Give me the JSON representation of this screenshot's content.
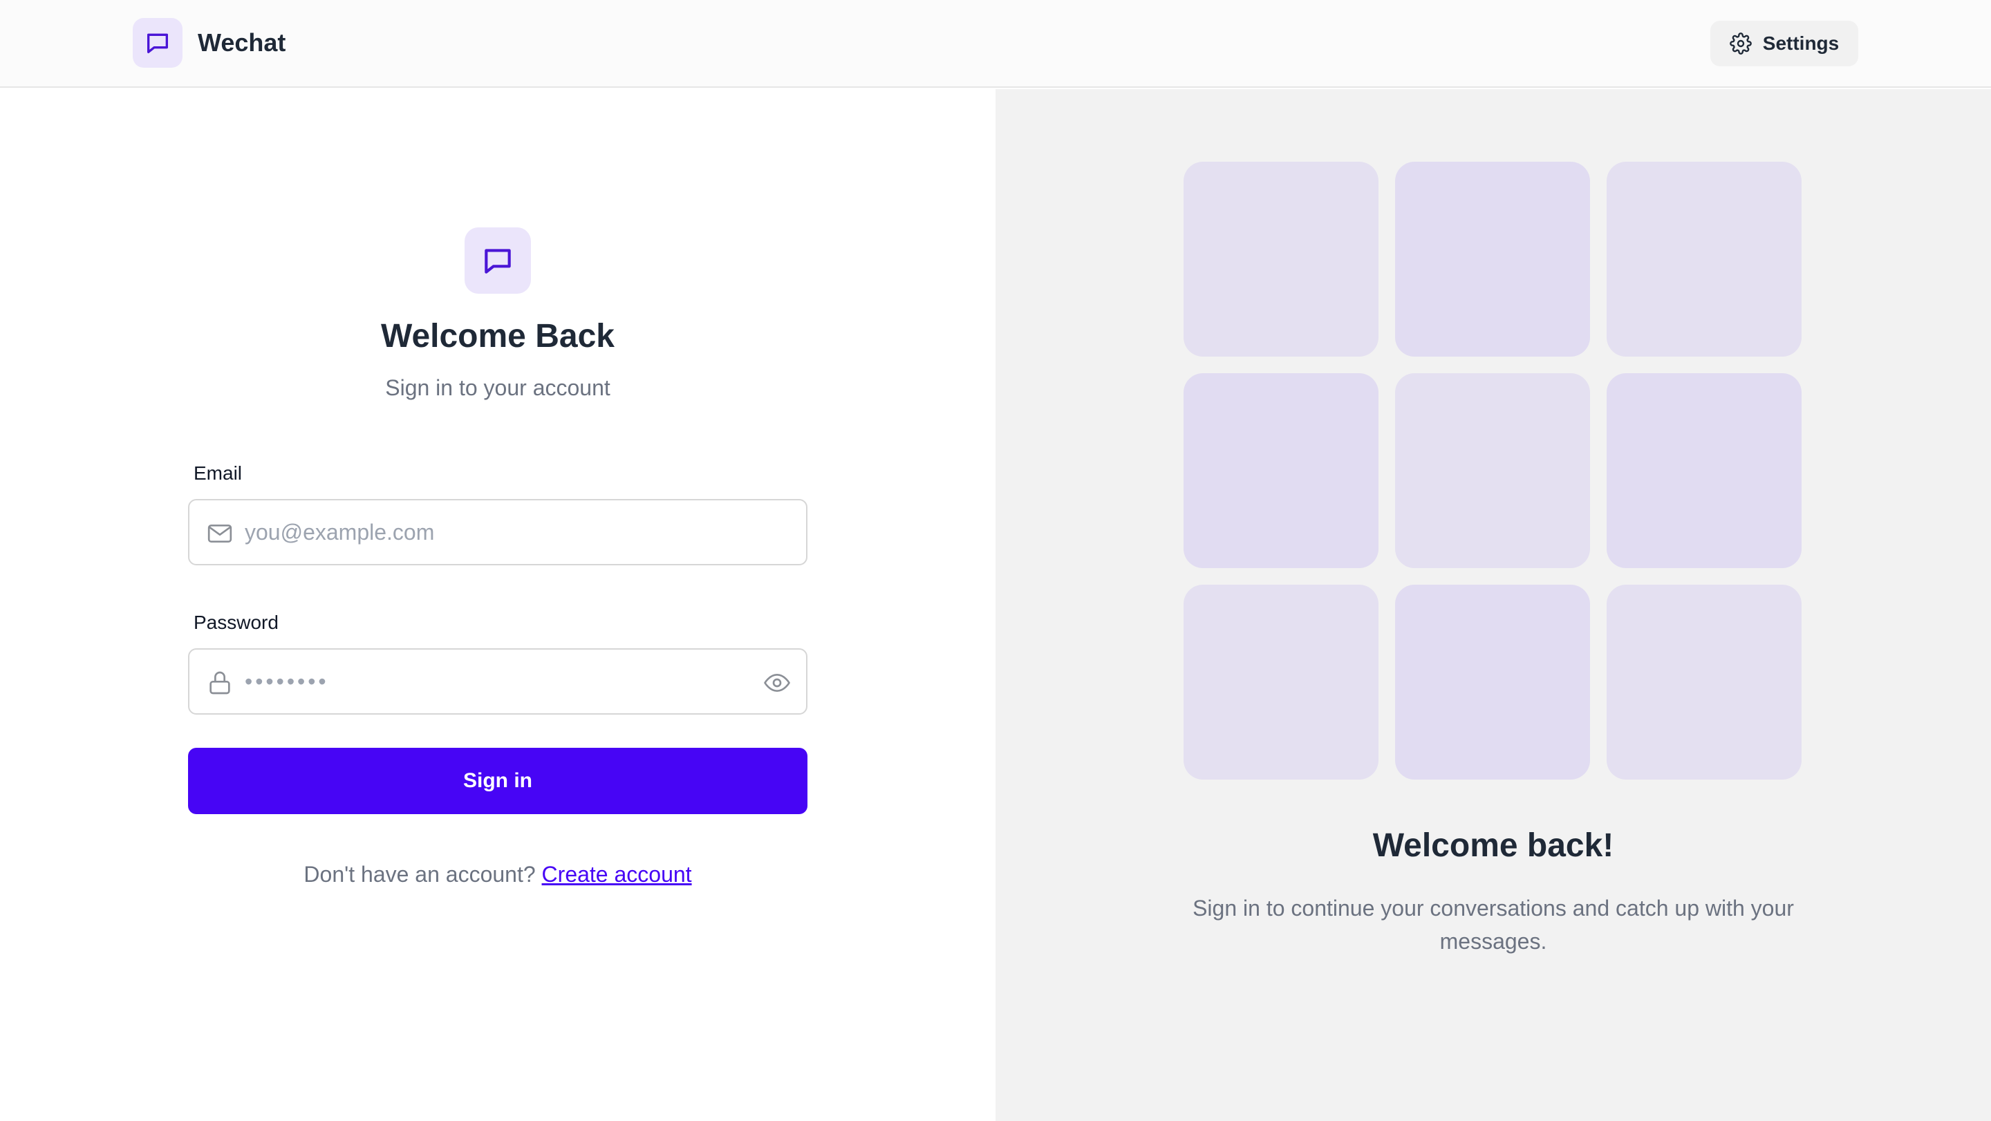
{
  "header": {
    "app_name": "Wechat",
    "logo_icon": "chat-bubble-icon",
    "settings_label": "Settings",
    "settings_icon": "gear-icon"
  },
  "login": {
    "hero_icon": "chat-bubble-icon",
    "title": "Welcome Back",
    "subtitle": "Sign in to your account",
    "email": {
      "label": "Email",
      "placeholder": "you@example.com",
      "value": "",
      "icon": "mail-icon"
    },
    "password": {
      "label": "Password",
      "placeholder": "••••••••",
      "value": "",
      "icon": "lock-icon",
      "toggle_icon": "eye-icon"
    },
    "submit_label": "Sign in",
    "signup_prompt": "Don't have an account?",
    "signup_link": "Create account"
  },
  "side_panel": {
    "title": "Welcome back!",
    "text": "Sign in to continue your conversations and catch up with your messages.",
    "tile_colors": [
      "#e4e0f1",
      "#e1dcf2",
      "#e4e0f1",
      "#e1dcf2",
      "#e4e0f1",
      "#e1dcf2",
      "#e4e0f1",
      "#e1dcf2",
      "#e4e0f1"
    ]
  },
  "colors": {
    "accent": "#4705f5",
    "icon_purple": "#4a15d6",
    "logo_bg": "#ebe5fb",
    "panel_bg": "#f2f2f2"
  }
}
